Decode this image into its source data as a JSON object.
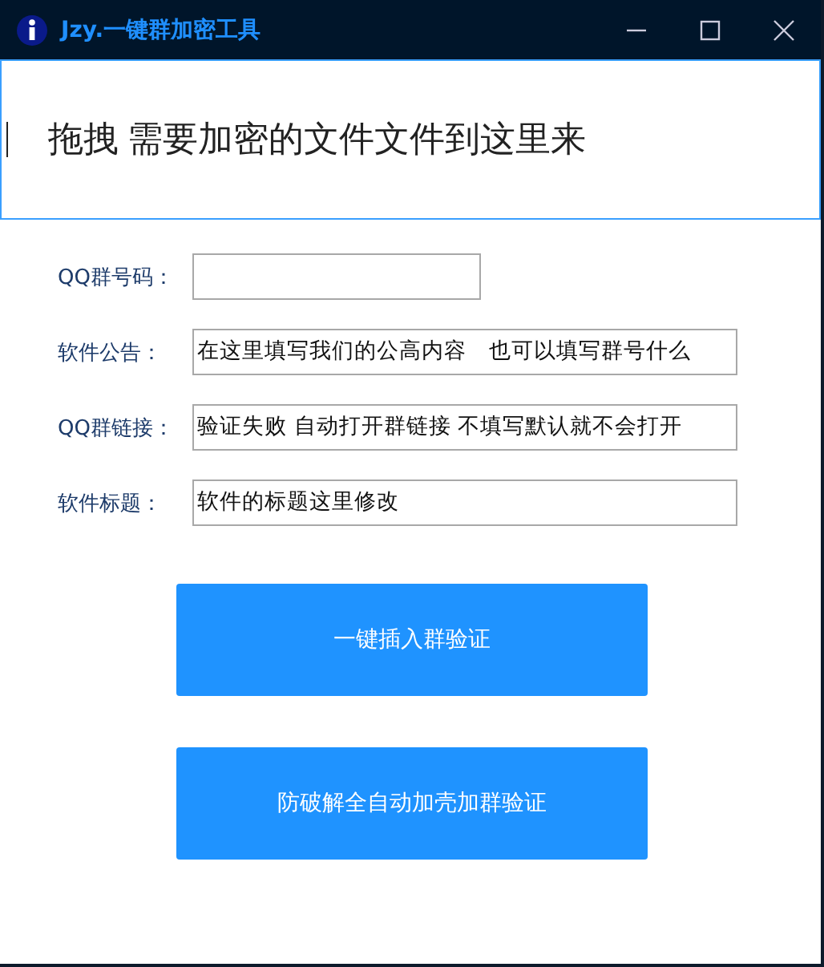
{
  "window": {
    "title": "Jzy.一键群加密工具"
  },
  "drop_zone": {
    "text": "拖拽 需要加密的文件文件到这里来"
  },
  "fields": [
    {
      "label": "QQ群号码："
    },
    {
      "label": "软件公告：",
      "value": "在这里填写我们的公高内容　也可以填写群号什么"
    },
    {
      "label": "QQ群链接：",
      "value": "验证失败 自动打开群链接 不填写默认就不会打开"
    },
    {
      "label": "软件标题：",
      "value": "软件的标题这里修改"
    }
  ],
  "buttons": [
    "一键插入群验证",
    "防破解全自动加壳加群验证"
  ]
}
